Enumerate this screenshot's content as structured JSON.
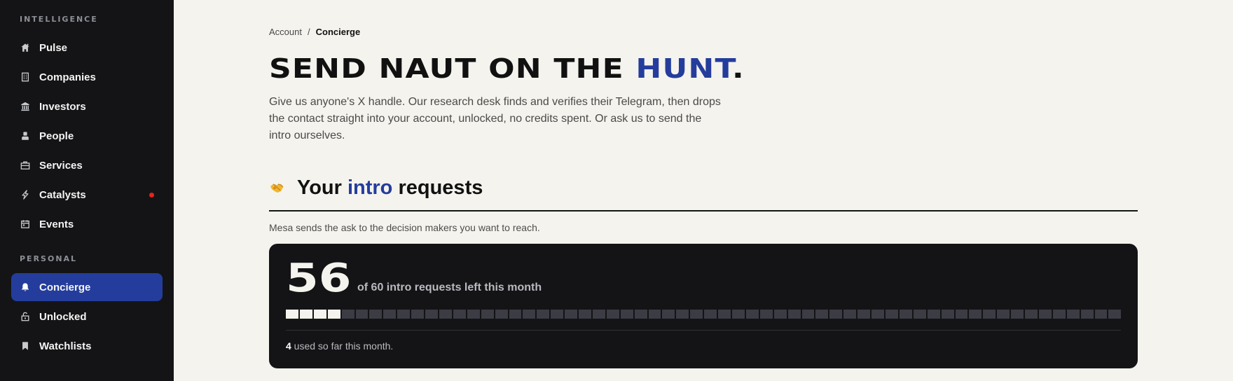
{
  "sidebar": {
    "sections": [
      {
        "label": "INTELLIGENCE",
        "items": [
          {
            "label": "Pulse",
            "icon": "home-icon"
          },
          {
            "label": "Companies",
            "icon": "building-icon"
          },
          {
            "label": "Investors",
            "icon": "bank-icon"
          },
          {
            "label": "People",
            "icon": "person-icon"
          },
          {
            "label": "Services",
            "icon": "briefcase-icon"
          },
          {
            "label": "Catalysts",
            "icon": "bolt-icon",
            "notification_dot": true
          },
          {
            "label": "Events",
            "icon": "calendar-icon"
          }
        ]
      },
      {
        "label": "PERSONAL",
        "items": [
          {
            "label": "Concierge",
            "icon": "bell-icon",
            "active": true
          },
          {
            "label": "Unlocked",
            "icon": "unlock-icon"
          },
          {
            "label": "Watchlists",
            "icon": "bookmark-icon"
          }
        ]
      }
    ]
  },
  "breadcrumb": {
    "parent": "Account",
    "separator": "/",
    "current": "Concierge"
  },
  "hero": {
    "title_pre": "SEND NAUT ON THE ",
    "title_accent": "HUNT",
    "title_post": ".",
    "description": "Give us anyone's X handle. Our research desk finds and verifies their Telegram, then drops the contact straight into your account, unlocked, no credits spent. Or ask us to send the intro ourselves."
  },
  "intro_section": {
    "icon": "handshake-icon",
    "heading_pre": "Your ",
    "heading_accent": "intro",
    "heading_post": " requests",
    "subtext": "Mesa sends the ask to the decision makers you want to reach."
  },
  "quota": {
    "remaining": "56",
    "label": "of 60 intro requests left this month",
    "total": 60,
    "used": 4,
    "used_count": "4",
    "used_suffix": " used so far this month."
  },
  "colors": {
    "accent": "#243d9c",
    "sidebar_bg": "#141416",
    "page_bg": "#f4f3ee",
    "notification": "#e0261f"
  }
}
